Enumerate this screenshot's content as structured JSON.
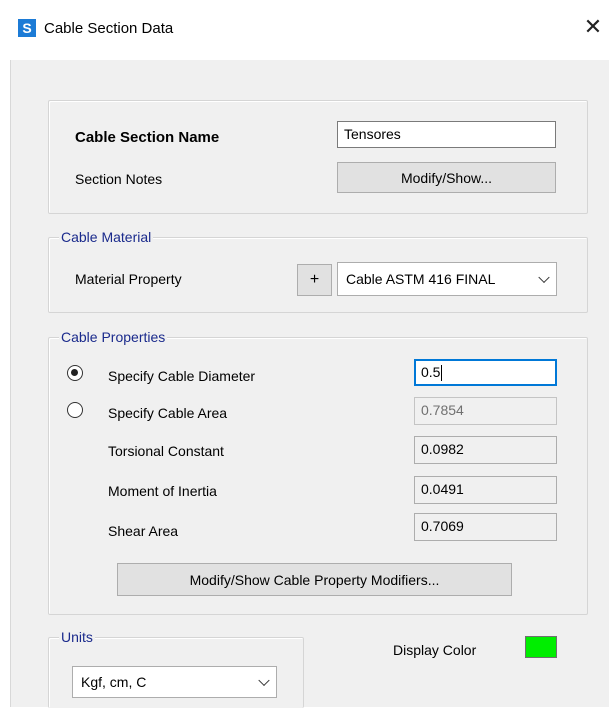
{
  "window": {
    "app_icon_letter": "S",
    "title": "Cable Section Data",
    "close_glyph": "✕"
  },
  "section": {
    "name_label": "Cable Section Name",
    "name_value": "Tensores",
    "notes_label": "Section Notes",
    "notes_button": "Modify/Show..."
  },
  "material": {
    "group_label": "Cable Material",
    "property_label": "Material Property",
    "add_button": "+",
    "selected": "Cable ASTM 416 FINAL"
  },
  "properties": {
    "group_label": "Cable Properties",
    "diameter_label": "Specify Cable Diameter",
    "diameter_value": "0.5",
    "diameter_selected": true,
    "area_label": "Specify Cable Area",
    "area_value": "0.7854",
    "torsional_label": "Torsional Constant",
    "torsional_value": "0.0982",
    "inertia_label": "Moment of Inertia",
    "inertia_value": "0.0491",
    "shear_label": "Shear Area",
    "shear_value": "0.7069",
    "modifiers_button": "Modify/Show Cable Property Modifiers..."
  },
  "units": {
    "group_label": "Units",
    "selected": "Kgf, cm, C"
  },
  "display_color": {
    "label": "Display Color",
    "color": "#00ee00"
  }
}
